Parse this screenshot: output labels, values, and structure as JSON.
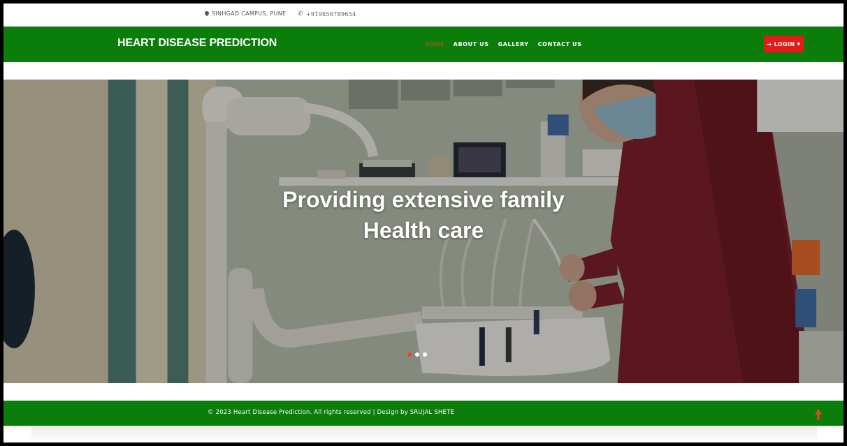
{
  "topbar": {
    "location": "SINHGAD CAMPUS, PUNE",
    "location_icon": "map-marker-icon",
    "phone": "+919856789654",
    "phone_icon": "phone-icon"
  },
  "navbar": {
    "brand": "HEART DISEASE PREDICTION",
    "links": [
      {
        "label": "HOME",
        "active": true
      },
      {
        "label": "ABOUT US",
        "active": false
      },
      {
        "label": "GALLERY",
        "active": false
      },
      {
        "label": "CONTACT US",
        "active": false
      }
    ],
    "login_label": "LOGIN",
    "login_icon": "sign-in-icon",
    "colors": {
      "navbar_bg": "#0a7d0a",
      "active_link": "#e5471d",
      "login_bg": "#e31b1b"
    }
  },
  "hero": {
    "title_line1": "Providing extensive family",
    "title_line2": "Health care",
    "slide_count": 3,
    "active_slide": 1
  },
  "footer": {
    "text": "© 2023 Heart Disease Prediction. All rights reserved | Design by SRUJAL SHETE",
    "scroll_top_icon": "arrow-up-icon"
  }
}
